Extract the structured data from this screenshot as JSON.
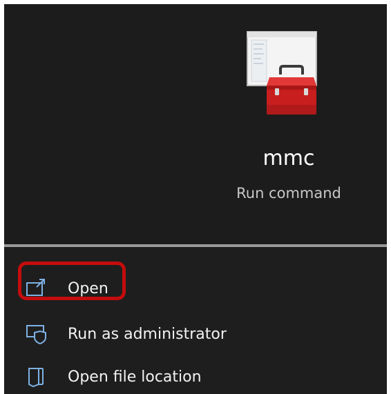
{
  "app": {
    "name": "mmc",
    "subtitle": "Run command",
    "icon": "toolbox-window-icon"
  },
  "actions": [
    {
      "label": "Open",
      "icon": "open-window-icon",
      "highlighted": true
    },
    {
      "label": "Run as administrator",
      "icon": "shield-admin-icon"
    },
    {
      "label": "Open file location",
      "icon": "folder-location-icon"
    }
  ],
  "colors": {
    "background": "#1c1c1c",
    "icon_stroke": "#7fb2e5",
    "highlight": "#c40c0c",
    "toolbox": "#d42424"
  }
}
